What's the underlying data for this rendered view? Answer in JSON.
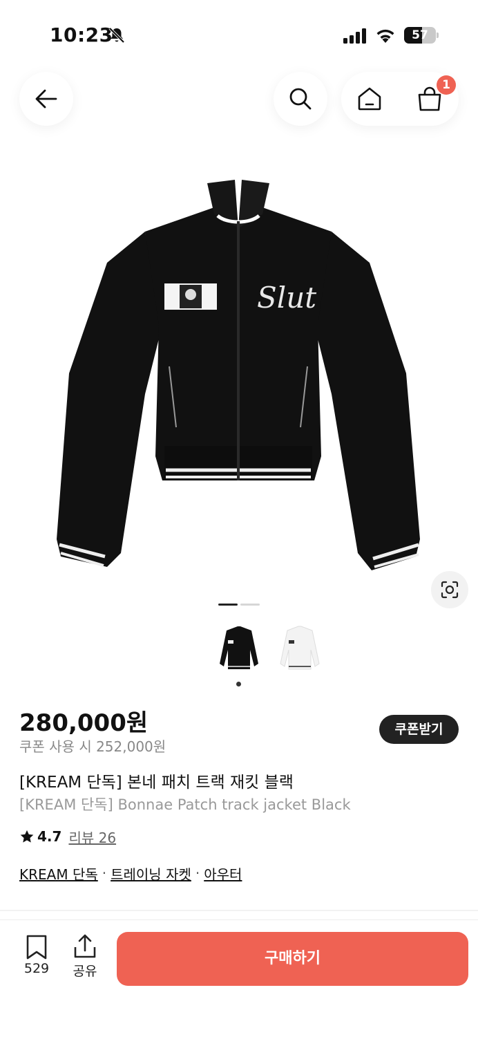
{
  "status_bar": {
    "time": "10:23",
    "battery": "57",
    "battery_level": 0.57,
    "icons": [
      "bell-slash-icon",
      "signal-icon",
      "wifi-icon",
      "battery-icon"
    ]
  },
  "nav": {
    "icons": [
      "arrow-left-icon",
      "search-icon",
      "home-icon",
      "shopping-bag-icon"
    ],
    "cart_count": "1"
  },
  "gallery": {
    "pages": 2,
    "current": 1,
    "thumbnails": [
      "black",
      "white"
    ],
    "lens_icon": "lens-scan-icon"
  },
  "product": {
    "price": "280,000원",
    "coupon_price": "쿠폰 사용 시 252,000원",
    "coupon_button": "쿠폰받기",
    "title_ko": "[KREAM 단독] 본네 패치 트랙 재킷 블랙",
    "title_en": "[KREAM 단독] Bonnae Patch track jacket Black",
    "rating": "4.7",
    "review_label": "리뷰 26",
    "categories": [
      "KREAM 단독",
      "트레이닝 자켓",
      "아우터"
    ],
    "separator": "·",
    "patch_text": "Slut"
  },
  "bottom_bar": {
    "bookmark_count": "529",
    "share_label": "공유",
    "buy_label": "구매하기"
  },
  "colors": {
    "accent": "#ef6253",
    "dark": "#222222",
    "muted": "#888888"
  }
}
